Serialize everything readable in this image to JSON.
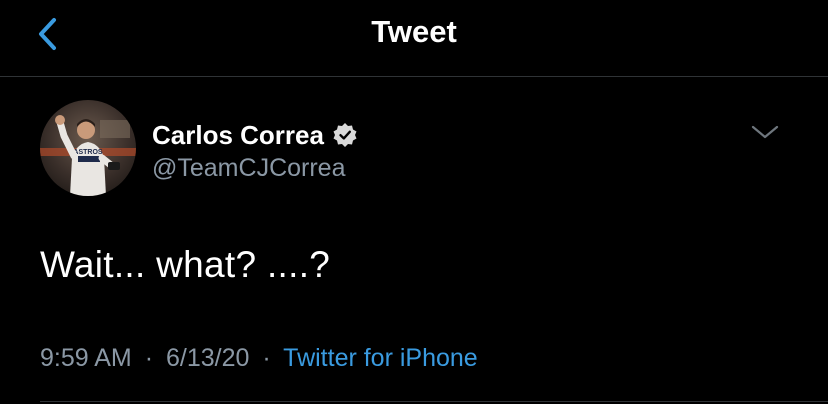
{
  "nav": {
    "title": "Tweet",
    "back_icon": "chevron-left-icon"
  },
  "author": {
    "name": "Carlos Correa",
    "handle": "@TeamCJCorrea",
    "verified": true
  },
  "tweet": {
    "text": "Wait... what? ....?",
    "time": "9:59 AM",
    "date": "6/13/20",
    "separator": "·",
    "source": "Twitter for iPhone"
  },
  "colors": {
    "background": "#000000",
    "text": "#ffffff",
    "secondary_text": "#8b98a5",
    "accent": "#3a9be0",
    "divider": "#2f3336"
  }
}
